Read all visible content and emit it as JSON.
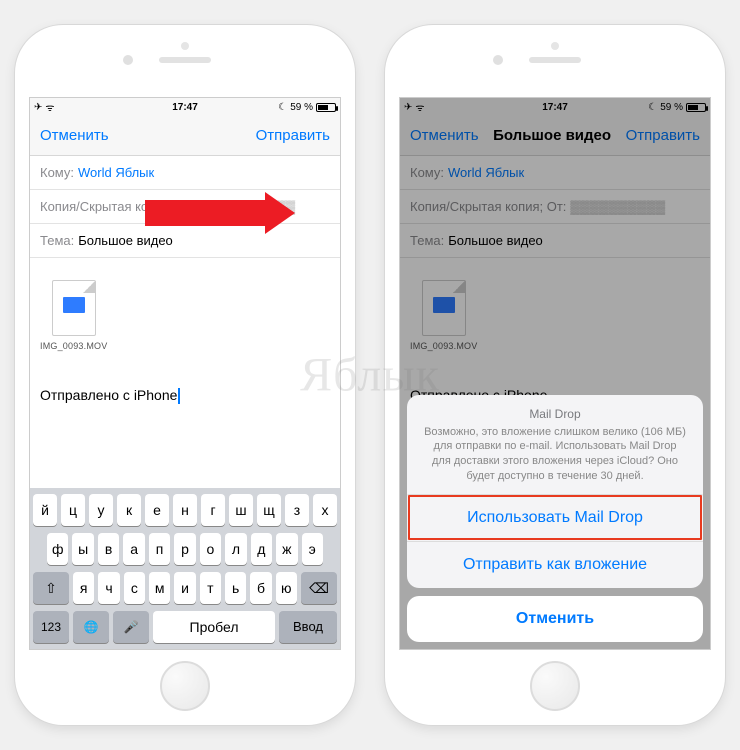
{
  "status": {
    "time": "17:47",
    "battery_pct": "59 %",
    "moon": "☾",
    "plane": "✈",
    "wifi": "ᯤ"
  },
  "left": {
    "nav_cancel": "Отменить",
    "nav_send": "Отправить",
    "to_label": "Кому:",
    "to_value": "World Яблык",
    "cc_label": "Копия/Скрытая копия; От:",
    "subject_label": "Тема:",
    "subject_value": "Большое видео",
    "attachment_name": "IMG_0093.MOV",
    "signature": "Отправлено с iPhone",
    "keys_r1": [
      "й",
      "ц",
      "у",
      "к",
      "е",
      "н",
      "г",
      "ш",
      "щ",
      "з",
      "х"
    ],
    "keys_r2": [
      "ф",
      "ы",
      "в",
      "а",
      "п",
      "р",
      "о",
      "л",
      "д",
      "ж",
      "э"
    ],
    "keys_r3": [
      "я",
      "ч",
      "с",
      "м",
      "и",
      "т",
      "ь",
      "б",
      "ю"
    ],
    "key_shift": "⇧",
    "key_back": "⌫",
    "key_123": "123",
    "key_globe": "🌐",
    "key_mic": "🎤",
    "key_space": "Пробел",
    "key_return": "Ввод"
  },
  "right": {
    "nav_cancel": "Отменить",
    "nav_title": "Большое видео",
    "nav_send": "Отправить",
    "sheet_title": "Mail Drop",
    "sheet_msg": "Возможно, это вложение слишком велико (106 МБ) для отправки по e-mail. Использовать Mail Drop для доставки этого вложения через iCloud? Оно будет доступно в течение 30 дней.",
    "btn_use": "Использовать Mail Drop",
    "btn_attach": "Отправить как вложение",
    "btn_cancel": "Отменить"
  },
  "watermark": "Яблык"
}
